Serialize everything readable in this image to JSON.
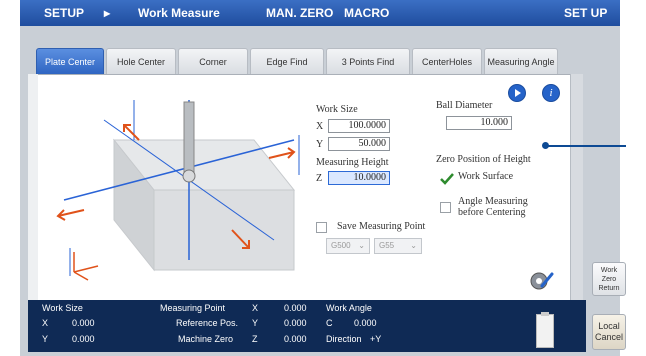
{
  "header": {
    "setup": "SETUP",
    "arrow": "▸",
    "work_measure": "Work Measure",
    "man_zero": "MAN. ZERO",
    "macro": "MACRO",
    "set_up": "SET UP"
  },
  "tabs": [
    {
      "label": "Plate Center"
    },
    {
      "label": "Hole Center"
    },
    {
      "label": "Corner"
    },
    {
      "label": "Edge Find"
    },
    {
      "label": "3 Points Find"
    },
    {
      "label": "CenterHoles"
    },
    {
      "label": "Measuring Angle"
    }
  ],
  "form": {
    "work_size_label": "Work Size",
    "x_label": "X",
    "x_value": "100.0000",
    "y_label": "Y",
    "y_value": "50.000",
    "measuring_height_label": "Measuring Height",
    "z_label": "Z",
    "z_value": "10.0000",
    "ball_diameter_label": "Ball Diameter",
    "ball_diameter_value": "10.000",
    "zero_position_label": "Zero Position of Height",
    "work_surface_label": "Work Surface",
    "angle_measuring_label_1": "Angle Measuring",
    "angle_measuring_label_2": "before Centering",
    "save_measuring_point_label": "Save Measuring Point",
    "dropdown1": "G500",
    "dropdown2": "G55"
  },
  "side_buttons": {
    "work_zero_return_1": "Work",
    "work_zero_return_2": "Zero",
    "work_zero_return_3": "Return",
    "local_cancel_1": "Local",
    "local_cancel_2": "Cancel"
  },
  "status": {
    "work_size": "Work Size",
    "x": "X",
    "x_val": "0.000",
    "y": "Y",
    "y_val": "0.000",
    "measuring_point": "Measuring Point",
    "mp_x": "X",
    "mp_x_val": "0.000",
    "reference_pos": "Reference Pos.",
    "rp_y": "Y",
    "rp_y_val": "0.000",
    "machine_zero": "Machine Zero",
    "mz_z": "Z",
    "mz_z_val": "0.000",
    "work_angle": "Work Angle",
    "c": "C",
    "c_val": "0.000",
    "direction": "Direction",
    "direction_val": "+Y"
  },
  "icons": [
    "play-icon",
    "info-icon",
    "wrench-gear-icon",
    "clipboard-icon",
    "check-icon"
  ]
}
